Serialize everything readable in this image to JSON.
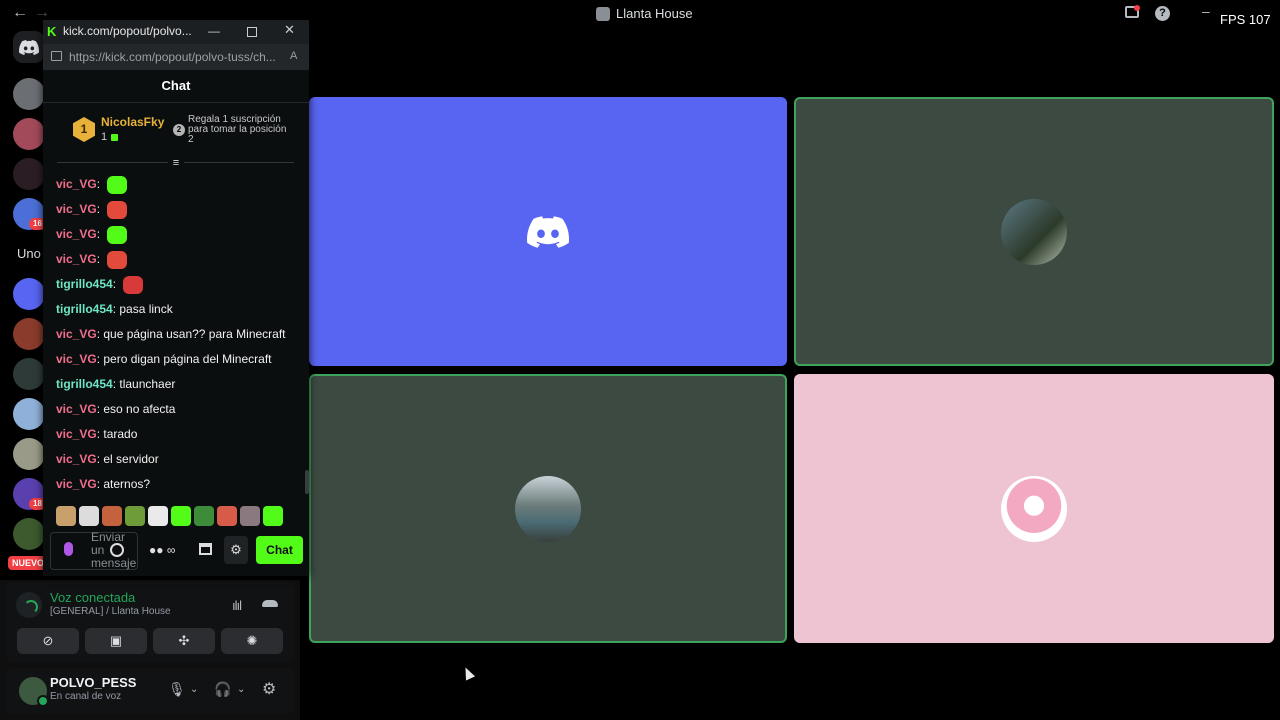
{
  "topbar": {
    "title": "Llanta House",
    "fps": "FPS 107"
  },
  "rail": {
    "badges": [
      "16",
      "18"
    ],
    "uno_label": "Uno",
    "nuevo_label": "NUEVO"
  },
  "popout": {
    "title": "kick.com/popout/polvo...",
    "url": "https://kick.com/popout/polvo-tuss/ch...",
    "chat_header": "Chat",
    "pinned": {
      "rank": "1",
      "name": "NicolasFky",
      "count": "1",
      "gift_position": "2",
      "gift_text": "Regala 1 suscripción para tomar la posición 2"
    },
    "messages": [
      {
        "user": "vic_VG",
        "text": "",
        "emote": "green-face",
        "color": "pink"
      },
      {
        "user": "vic_VG",
        "text": "",
        "emote": "red-face",
        "color": "pink"
      },
      {
        "user": "vic_VG",
        "text": "",
        "emote": "green-face",
        "color": "pink"
      },
      {
        "user": "vic_VG",
        "text": "",
        "emote": "red-face",
        "color": "pink"
      },
      {
        "user": "tigrillo454",
        "text": "",
        "emote": "red-angry",
        "color": "teal"
      },
      {
        "user": "tigrillo454",
        "text": "pasa linck",
        "emote": "",
        "color": "teal"
      },
      {
        "user": "vic_VG",
        "text": "que página usan?? para Minecraft",
        "emote": "",
        "color": "pink"
      },
      {
        "user": "vic_VG",
        "text": "pero digan página del Minecraft",
        "emote": "",
        "color": "pink"
      },
      {
        "user": "tigrillo454",
        "text": "tlaunchaer",
        "emote": "",
        "color": "teal"
      },
      {
        "user": "vic_VG",
        "text": "eso no afecta",
        "emote": "",
        "color": "pink"
      },
      {
        "user": "vic_VG",
        "text": "tarado",
        "emote": "",
        "color": "pink"
      },
      {
        "user": "vic_VG",
        "text": "el servidor",
        "emote": "",
        "color": "pink"
      },
      {
        "user": "vic_VG",
        "text": "aternos?",
        "emote": "",
        "color": "pink"
      }
    ],
    "input_placeholder": "Enviar un mensaje",
    "points_label": "∞",
    "send_label": "Chat"
  },
  "voice": {
    "status": "Voz conectada",
    "channel": "[GENERAL] / Llanta House"
  },
  "user": {
    "name": "POLVO_PESS",
    "status": "En canal de voz"
  },
  "colors": {
    "kick_green": "#53fc18",
    "discord_blurple": "#5865f2",
    "speaking_green": "#3fa35b",
    "pink_tile": "#efc4d2",
    "user_pink": "#f06f8e",
    "user_teal": "#6ee6c6"
  }
}
